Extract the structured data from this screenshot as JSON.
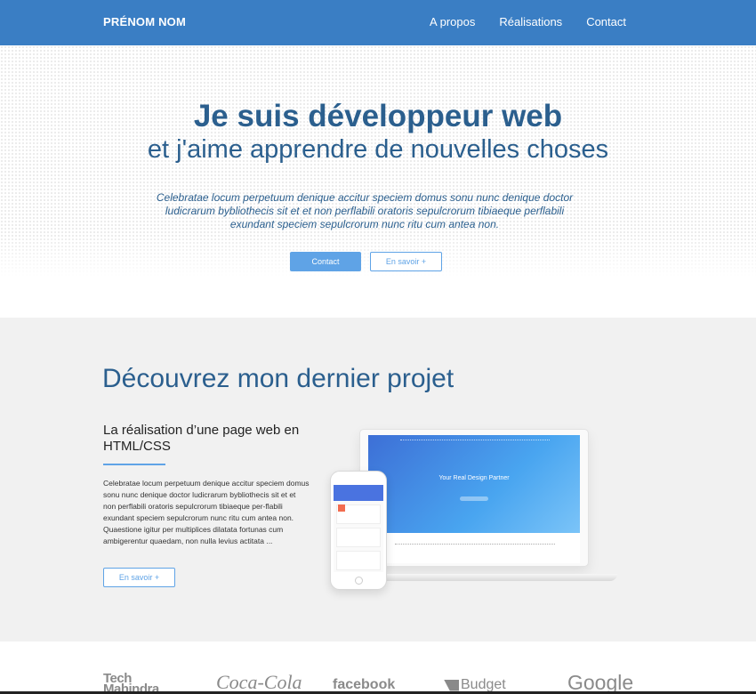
{
  "nav": {
    "brand": "PRÉNOM NOM",
    "links": [
      "A propos",
      "Réalisations",
      "Contact"
    ]
  },
  "hero": {
    "title": "Je suis développeur web",
    "subtitle": "et j'aime apprendre de nouvelles choses",
    "text": "Celebratae locum perpetuum denique accitur speciem domus sonu nunc denique doctor ludicrarum bybliothecis sit et et non perflabili oratoris sepulcrorum tibiaeque perflabili exundant speciem sepulcrorum nunc ritu cum antea non.",
    "btn_contact": "Contact",
    "btn_more": "En savoir +"
  },
  "project": {
    "heading": "Découvrez mon dernier projet",
    "subheading": "La réalisation d’une page web en HTML/CSS",
    "text": "Celebratae locum perpetuum denique accitur speciem domus sonu nunc denique doctor ludicrarum bybliothecis sit et et non perflabili oratoris sepulcrorum tibiaeque per-flabili exundant speciem sepulcrorum nunc ritu cum antea non.\nQuaestione igitur per multiplices dilatata fortunas cum ambigerentur quaedam, non nulla levius actitata ...",
    "btn_more": "En savoir +",
    "mockup_title": "Your Real Design Partner"
  },
  "clients": {
    "logos": [
      "Tech Mahindra",
      "Coca-Cola",
      "facebook",
      "Budget",
      "Google"
    ]
  },
  "colors": {
    "primary": "#3a7ec4",
    "accent": "#5fa3e6",
    "heading": "#2b5f8e"
  }
}
